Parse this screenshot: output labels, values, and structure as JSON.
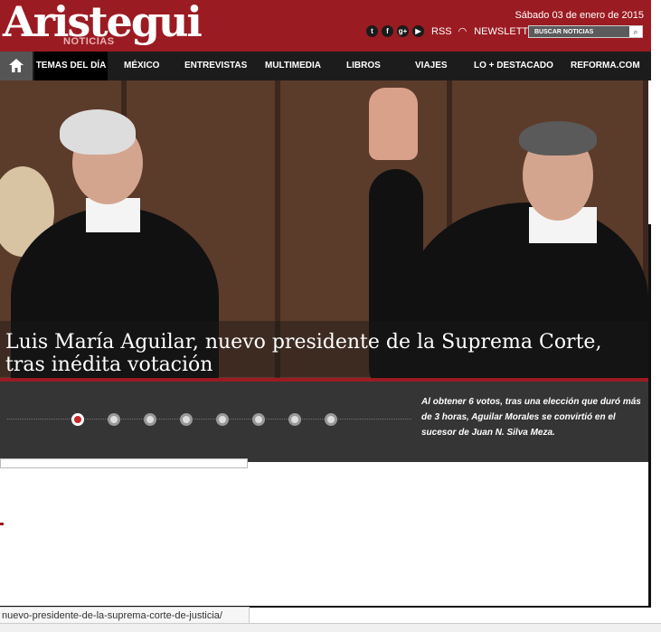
{
  "header": {
    "logo": "Aristegui",
    "logo_sub": "NOTICIAS",
    "date": "Sábado 03 de enero de 2015",
    "social_icons": [
      "twitter-icon",
      "facebook-icon",
      "google-plus-icon",
      "youtube-icon"
    ],
    "rss_label": "RSS",
    "newsletter_label": "NEWSLETTER",
    "search_placeholder": "BUSCAR NOTICIAS"
  },
  "nav": {
    "home_icon": "home-icon",
    "items": [
      "TEMAS DEL DÍA",
      "MÉXICO",
      "ENTREVISTAS",
      "MULTIMEDIA",
      "LIBROS",
      "VIAJES",
      "LO + DESTACADO",
      "REFORMA.COM"
    ]
  },
  "hero": {
    "headline": "Luis María Aguilar, nuevo presidente de la Suprema Corte, tras inédita votación",
    "summary": "Al obtener 6 votos, tras una elección que duró más de 3 horas, Aguilar Morales se convirtió en el sucesor de Juan N. Silva Meza.",
    "slide_count": 8,
    "active_slide": 1
  },
  "status_bar": {
    "url": "nuevo-presidente-de-la-suprema-corte-de-justicia/"
  }
}
